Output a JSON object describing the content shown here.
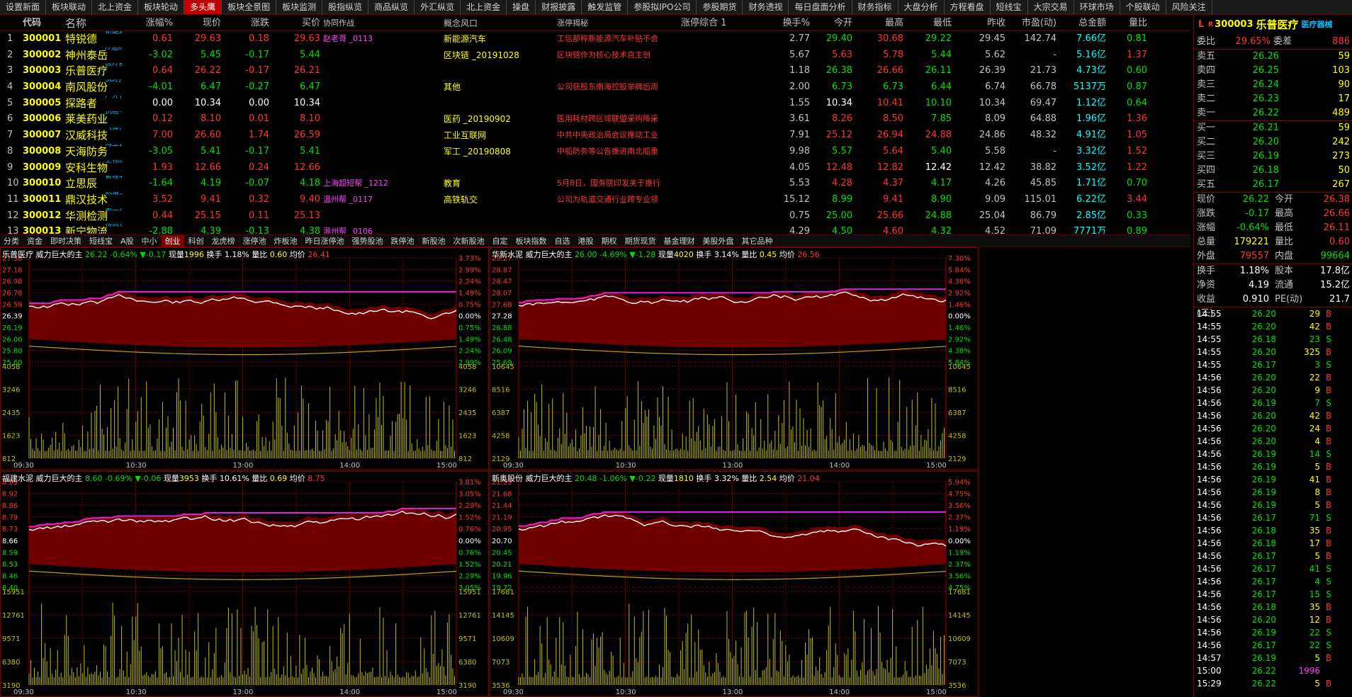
{
  "menu": [
    "设置新面",
    "板块联动",
    "北上资金",
    "板块轮动",
    "多头鹰",
    "板块全景图",
    "板块监测",
    "股指纵览",
    "商品纵览",
    "外汇纵览",
    "北上资金",
    "操盘",
    "财报披露",
    "触发监管",
    "参股拟IPO公司",
    "参股期货",
    "财务透视",
    "每日盘面分析",
    "财务指标",
    "大盘分析",
    "方程看盘",
    "短线宝",
    "大宗交易",
    "环球市场",
    "个股联动",
    "风险关注"
  ],
  "menu_active": 4,
  "headers": [
    "",
    "代码",
    "名称",
    "涨幅%",
    "现价",
    "涨跌",
    "买价",
    "协同作战",
    "概念风口",
    "涨停揭秘",
    "涨停综合 1",
    "换手%",
    "今开",
    "最高",
    "最低",
    "昨收",
    "市盈(动)",
    "总金额",
    "量比"
  ],
  "rows": [
    [
      "1",
      "300001",
      "特锐德",
      "新能源汽车",
      "R",
      "0.61",
      "29.63",
      "0.18",
      "29.63",
      "赵老哥  _0113",
      "新能源汽车",
      "工信部称新能源汽车补贴不会",
      "",
      "2.77",
      "29.40",
      "30.68",
      "29.22",
      "29.45",
      "142.74",
      "7.66亿",
      "0.81"
    ],
    [
      "2",
      "300002",
      "神州泰岳",
      "IT运维+?",
      "R",
      "-3.02",
      "5.45",
      "-0.17",
      "5.44",
      "",
      "区块链  _20191028",
      "区块链作为核心技术自主创",
      "",
      "5.67",
      "5.63",
      "5.78",
      "5.44",
      "5.62",
      "-",
      "5.16亿",
      "1.37"
    ],
    [
      "3",
      "300003",
      "乐普医疗",
      "医疗器械",
      "R",
      "0.64",
      "26.22",
      "-0.17",
      "26.21",
      "",
      "",
      "",
      "",
      "1.18",
      "26.38",
      "26.66",
      "26.11",
      "26.39",
      "21.73",
      "4.73亿",
      "0.60"
    ],
    [
      "4",
      "300004",
      "南风股份",
      "3D打印+?",
      "",
      "-4.01",
      "6.47",
      "-0.27",
      "6.47",
      "",
      "其他",
      "公司获股东南海控股举牌后周",
      "",
      "2.00",
      "6.73",
      "6.73",
      "6.44",
      "6.74",
      "66.78",
      "5137万",
      "0.87"
    ],
    [
      "5",
      "300005",
      "探路者",
      "户外行业",
      "",
      "0.00",
      "10.34",
      "0.00",
      "10.34",
      "",
      "",
      "",
      "",
      "1.55",
      "10.34",
      "10.41",
      "10.10",
      "10.34",
      "69.47",
      "1.12亿",
      "0.64"
    ],
    [
      "6",
      "300006",
      "莱美药业",
      "抗癌+?",
      "R",
      "0.12",
      "8.10",
      "0.01",
      "8.10",
      "",
      "医药  _20190902",
      "医用耗材跨区域联盟采购降采",
      "",
      "3.61",
      "8.26",
      "8.50",
      "7.85",
      "8.09",
      "64.88",
      "1.96亿",
      "1.36"
    ],
    [
      "7",
      "300007",
      "汉威科技",
      "气体传感",
      "",
      "7.00",
      "26.60",
      "1.74",
      "26.59",
      "",
      "工业互联网",
      "中共中央政治局会议推动工业",
      "",
      "7.91",
      "25.12",
      "26.94",
      "24.88",
      "24.86",
      "48.32",
      "4.91亿",
      "1.05"
    ],
    [
      "8",
      "300008",
      "天海防务",
      "海工设计",
      "",
      "-3.05",
      "5.41",
      "-0.17",
      "5.41",
      "",
      "军工  _20190808",
      "中船防务等公告推进南北船重",
      "",
      "9.98",
      "5.57",
      "5.64",
      "5.40",
      "5.58",
      "-",
      "3.32亿",
      "1.52"
    ],
    [
      "9",
      "300009",
      "安科生物",
      "生物制药",
      "R",
      "1.93",
      "12.66",
      "0.24",
      "12.66",
      "",
      "",
      "",
      "",
      "4.05",
      "12.48",
      "12.82",
      "12.42",
      "12.42",
      "38.82",
      "3.52亿",
      "1.22"
    ],
    [
      "10",
      "300010",
      "立思辰",
      "管理软件",
      "R",
      "-1.64",
      "4.19",
      "-0.07",
      "4.18",
      "上海超短帮  _1212",
      "教育",
      "5月8日，国务院印发关于推行",
      "",
      "5.53",
      "4.28",
      "4.37",
      "4.17",
      "4.26",
      "45.85",
      "1.71亿",
      "0.70"
    ],
    [
      "11",
      "300011",
      "鼎汉技术",
      "轨道交通",
      "",
      "3.52",
      "9.41",
      "0.32",
      "9.40",
      "温州帮  _0117",
      "高铁轨交",
      "公司为轨道交通行业跨专业领",
      "",
      "15.12",
      "8.99",
      "9.41",
      "8.90",
      "9.09",
      "115.01",
      "6.22亿",
      "3.44"
    ],
    [
      "12",
      "300012",
      "华测检测",
      "第三方检",
      "R",
      "0.44",
      "25.15",
      "0.11",
      "25.13",
      "",
      "",
      "",
      "",
      "0.75",
      "25.00",
      "25.66",
      "24.88",
      "25.04",
      "86.79",
      "2.85亿",
      "0.33"
    ],
    [
      "13",
      "300013",
      "新宁物流",
      "物流仓储",
      "",
      "-2.88",
      "4.39",
      "-0.13",
      "4.38",
      "温州帮  _0106",
      "",
      "",
      "",
      "4.29",
      "4.50",
      "4.60",
      "4.32",
      "4.52",
      "71.09",
      "7771万",
      "0.89"
    ]
  ],
  "tabs": [
    "分类",
    "资金",
    "即时决策",
    "短线宝",
    "A股",
    "中小",
    "创业",
    "科创",
    "龙虎榜",
    "涨停池",
    "炸板池",
    "昨日涨停池",
    "强势股池",
    "跌停池",
    "新股池",
    "次新股池",
    "自定",
    "板块指数",
    "自选",
    "港股",
    "期权",
    "期货现货",
    "基金理财",
    "美股外盘",
    "其它品种"
  ],
  "tabs_selected": 6,
  "charts": [
    {
      "name": "乐普医疗",
      "label": "威力巨大的主",
      "price": "26.22",
      "pct": "-0.64%",
      "chg": "▼-0.17",
      "vol_label": "现量",
      "vol": "1996",
      "turn_label": "换手",
      "turn": "1.18%",
      "lb_label": "量比",
      "lb": "0.60",
      "avg_label": "均价",
      "avg": "26.41",
      "y_left": [
        "27.38",
        "27.18",
        "26.98",
        "26.78",
        "26.59",
        "26.39",
        "26.19",
        "26.00",
        "25.80",
        "25.60"
      ],
      "y_right": [
        "3.73%",
        "2.99%",
        "2.24%",
        "1.49%",
        "0.75%",
        "0.00%",
        "0.75%",
        "1.49%",
        "2.24%",
        "2.99%"
      ],
      "vol_left": [
        "4058",
        "3246",
        "2435",
        "1623",
        "812"
      ],
      "times": [
        "09:30",
        "10:30",
        "13:00",
        "14:00",
        "15:00"
      ]
    },
    {
      "name": "华新水泥",
      "label": "威力巨大的主",
      "price": "26.00",
      "pct": "-4.69%",
      "chg": "▼-1.28",
      "vol_label": "现量",
      "vol": "4020",
      "turn_label": "换手",
      "turn": "3.14%",
      "lb_label": "量比",
      "lb": "0.45",
      "avg_label": "均价",
      "avg": "26.56",
      "y_left": [
        "29.27",
        "28.87",
        "28.47",
        "28.07",
        "27.68",
        "27.28",
        "26.88",
        "26.48",
        "26.09",
        "25.69"
      ],
      "y_right": [
        "7.30%",
        "5.84%",
        "4.38%",
        "2.92%",
        "1.46%",
        "0.00%",
        "1.46%",
        "2.92%",
        "4.38%",
        "5.84%"
      ],
      "vol_left": [
        "10645",
        "8516",
        "6387",
        "4258",
        "2129"
      ],
      "times": [
        "09:30",
        "10:30",
        "13:00",
        "14:00",
        "15:00"
      ]
    },
    {
      "name": "福建水泥",
      "label": "威力巨大的主",
      "price": "8.60",
      "pct": "-0.69%",
      "chg": "▼-0.06",
      "vol_label": "现量",
      "vol": "3953",
      "turn_label": "换手",
      "turn": "10.61%",
      "lb_label": "量比",
      "lb": "0.69",
      "avg_label": "均价",
      "avg": "8.75",
      "y_left": [
        "8.99",
        "8.92",
        "8.86",
        "8.79",
        "8.73",
        "8.66",
        "8.59",
        "8.53",
        "8.46",
        "8.40"
      ],
      "y_right": [
        "3.81%",
        "3.05%",
        "2.29%",
        "1.52%",
        "0.76%",
        "0.00%",
        "0.76%",
        "1.52%",
        "2.29%",
        "3.05%"
      ],
      "vol_left": [
        "15951",
        "12761",
        "9571",
        "6380",
        "3190"
      ],
      "times": [
        "09:30",
        "10:30",
        "13:00",
        "14:00",
        "15:00"
      ]
    },
    {
      "name": "新奥股份",
      "label": "威力巨大的主",
      "price": "20.48",
      "pct": "-1.06%",
      "chg": "▼-0.22",
      "vol_label": "现量",
      "vol": "1810",
      "turn_label": "换手",
      "turn": "3.32%",
      "lb_label": "量比",
      "lb": "2.54",
      "avg_label": "均价",
      "avg": "21.04",
      "y_left": [
        "21.93",
        "21.68",
        "21.44",
        "21.19",
        "20.95",
        "20.70",
        "20.45",
        "20.21",
        "19.96",
        "19.72"
      ],
      "y_right": [
        "5.94%",
        "4.75%",
        "3.56%",
        "2.37%",
        "1.19%",
        "0.00%",
        "1.19%",
        "2.37%",
        "3.56%",
        "4.75%"
      ],
      "vol_left": [
        "17681",
        "14145",
        "10609",
        "7073",
        "3536"
      ],
      "times": [
        "09:30",
        "10:30",
        "13:00",
        "14:00",
        "15:00"
      ]
    }
  ],
  "panel": {
    "badge": "L",
    "r": "R",
    "code": "300003",
    "name": "乐普医疗",
    "sector": "医疗器械",
    "wb_label": "委比",
    "wb": "29.65%",
    "wc_label": "委差",
    "wc": "886",
    "asks": [
      [
        "卖五",
        "26.26",
        "59"
      ],
      [
        "卖四",
        "26.25",
        "103"
      ],
      [
        "卖三",
        "26.24",
        "90"
      ],
      [
        "卖二",
        "26.23",
        "17"
      ],
      [
        "卖一",
        "26.22",
        "489"
      ]
    ],
    "bids": [
      [
        "买一",
        "26.21",
        "59"
      ],
      [
        "买二",
        "26.20",
        "242"
      ],
      [
        "买三",
        "26.19",
        "273"
      ],
      [
        "买四",
        "26.18",
        "50"
      ],
      [
        "买五",
        "26.17",
        "267"
      ]
    ],
    "stats": [
      [
        "现价",
        "26.22",
        "今开",
        "26.38"
      ],
      [
        "涨跌",
        "-0.17",
        "最高",
        "26.66"
      ],
      [
        "涨幅",
        "-0.64%",
        "最低",
        "26.11"
      ],
      [
        "总量",
        "179221",
        "量比",
        "0.60"
      ],
      [
        "外盘",
        "79557",
        "内盘",
        "99664"
      ]
    ],
    "stats2": [
      [
        "换手",
        "1.18%",
        "股本",
        "17.8亿"
      ],
      [
        "净资",
        "4.19",
        "流通",
        "15.2亿"
      ],
      [
        "收益(三)",
        "0.910",
        "PE(动)",
        "21.7"
      ]
    ],
    "ticks": [
      [
        "14:55",
        "26.20",
        "29",
        "B"
      ],
      [
        "14:55",
        "26.20",
        "42",
        "B"
      ],
      [
        "14:55",
        "26.18",
        "23",
        "S"
      ],
      [
        "14:55",
        "26.20",
        "325",
        "B"
      ],
      [
        "14:55",
        "26.17",
        "3",
        "S"
      ],
      [
        "14:56",
        "26.20",
        "22",
        "B"
      ],
      [
        "14:56",
        "26.20",
        "9",
        "B"
      ],
      [
        "14:56",
        "26.19",
        "7",
        "S"
      ],
      [
        "14:56",
        "26.20",
        "42",
        "B"
      ],
      [
        "14:56",
        "26.20",
        "24",
        "B"
      ],
      [
        "14:56",
        "26.20",
        "4",
        "B"
      ],
      [
        "14:56",
        "26.19",
        "14",
        "S"
      ],
      [
        "14:56",
        "26.19",
        "5",
        "B"
      ],
      [
        "14:56",
        "26.19",
        "41",
        "B"
      ],
      [
        "14:56",
        "26.19",
        "8",
        "B"
      ],
      [
        "14:56",
        "26.19",
        "5",
        "B"
      ],
      [
        "14:56",
        "26.17",
        "71",
        "S"
      ],
      [
        "14:56",
        "26.18",
        "35",
        "B"
      ],
      [
        "14:56",
        "26.18",
        "17",
        "B"
      ],
      [
        "14:56",
        "26.17",
        "5",
        "B"
      ],
      [
        "14:56",
        "26.17",
        "41",
        "S"
      ],
      [
        "14:56",
        "26.17",
        "4",
        "S"
      ],
      [
        "14:56",
        "26.17",
        "15",
        "S"
      ],
      [
        "14:56",
        "26.18",
        "35",
        "B"
      ],
      [
        "14:56",
        "26.20",
        "12",
        "B"
      ],
      [
        "14:56",
        "26.19",
        "22",
        "S"
      ],
      [
        "14:56",
        "26.17",
        "22",
        "S"
      ],
      [
        "14:57",
        "26.19",
        "5",
        "B"
      ],
      [
        "15:00",
        "26.22",
        "1996",
        ""
      ],
      [
        "15:29",
        "26.22",
        "5",
        "B"
      ]
    ]
  }
}
